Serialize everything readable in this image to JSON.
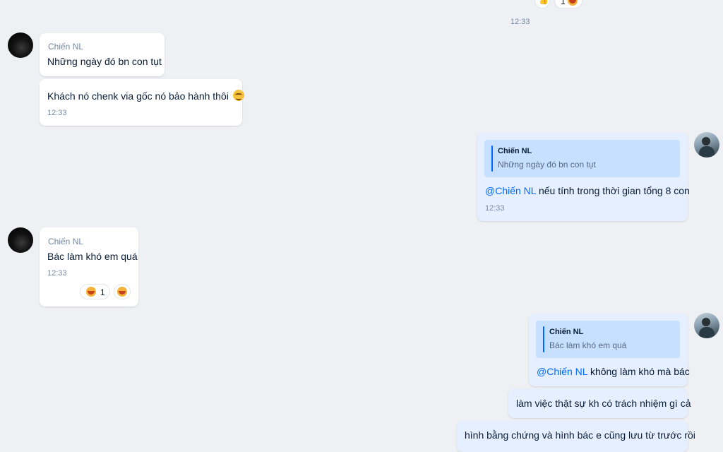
{
  "top": {
    "reaction_count": "1",
    "time": "12:33"
  },
  "messages": {
    "m1": {
      "sender": "Chiến NL",
      "text": "Những ngày đó bn con tụt"
    },
    "m2": {
      "text": "Khách nó chenk via gốc nó bảo hành thôi",
      "emoji": "relieved-face-emoji",
      "time": "12:33"
    },
    "m3": {
      "quote_name": "Chiến NL",
      "quote_text": "Những ngày đó bn con tụt",
      "mention": "@Chiến NL",
      "text": " nếu tính trong thời gian tổng 8 con",
      "time": "12:33"
    },
    "m4": {
      "sender": "Chiến NL",
      "text": "Bác làm khó em quá",
      "time": "12:33",
      "reaction_count": "1",
      "reaction_emoji": "laughing-face-emoji"
    },
    "m5": {
      "quote_name": "Chiến NL",
      "quote_text": "Bác làm khó em quá",
      "mention": "@Chiến NL",
      "text": " không làm khó mà bác"
    },
    "m6": {
      "text": "làm việc thật sự kh có trách nhiệm gì cả"
    },
    "m7": {
      "text": "hình bằng chứng và hình bác e cũng lưu từ trước rồi"
    }
  },
  "colors": {
    "background": "#eef0f4",
    "outgoing": "#e5efff",
    "incoming": "#ffffff",
    "mention": "#0068ff",
    "quote": "#c7e0ff"
  }
}
